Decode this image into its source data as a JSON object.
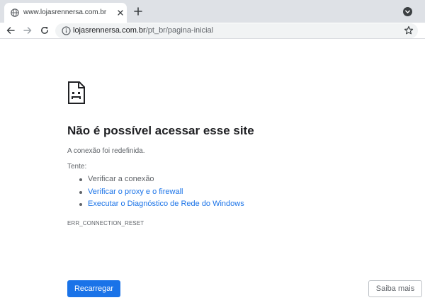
{
  "browser": {
    "tab": {
      "title": "www.lojasrennersa.com.br",
      "favicon": "globe-icon"
    },
    "address_bar": {
      "host": "lojasrennersa.com.br",
      "path": "/pt_br/pagina-inicial"
    },
    "icons": {
      "back": "arrow-left-icon",
      "forward": "arrow-right-icon",
      "reload": "reload-icon",
      "info": "info-icon",
      "bookmark": "star-icon",
      "new_tab": "plus-icon",
      "tab_search": "chevron-down-icon"
    }
  },
  "error_page": {
    "icon": "sad-page-icon",
    "title": "Não é possível acessar esse site",
    "description": "A conexão foi redefinida.",
    "try_label": "Tente:",
    "suggestions": [
      {
        "text": "Verificar a conexão",
        "is_link": false
      },
      {
        "text": "Verificar o proxy e o firewall",
        "is_link": true
      },
      {
        "text": "Executar o Diagnóstico de Rede do Windows",
        "is_link": true
      }
    ],
    "error_code": "ERR_CONNECTION_RESET",
    "buttons": {
      "reload": "Recarregar",
      "details": "Saiba mais"
    }
  },
  "colors": {
    "primary_blue": "#1a73e8",
    "text_primary": "#202124",
    "text_secondary": "#5f6368",
    "tabstrip_bg": "#dee1e6",
    "omnibox_bg": "#f1f3f4"
  }
}
